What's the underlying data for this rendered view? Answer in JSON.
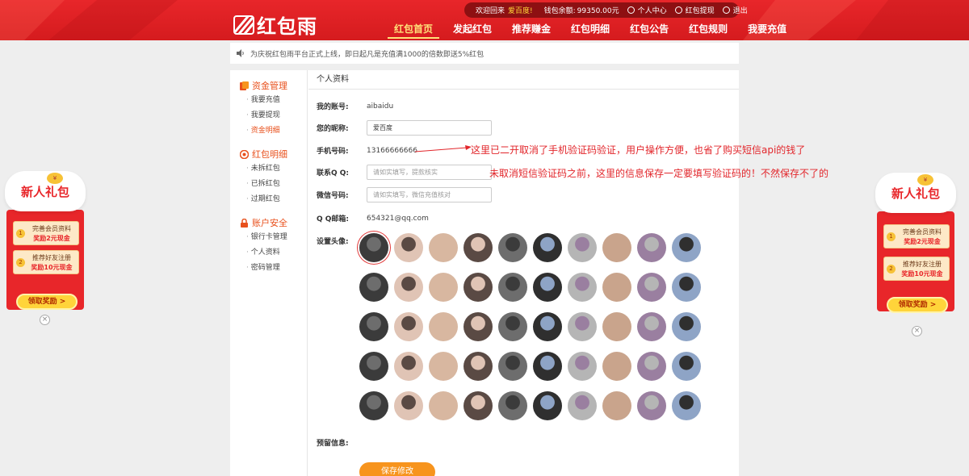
{
  "brand": {
    "logo_text": "红包雨"
  },
  "topbar": {
    "welcome_prefix": "欢迎回来",
    "username": "爱百度!",
    "balance_label": "钱包余额:",
    "balance_value": "99350.00元",
    "user_center": "个人中心",
    "withdraw": "红包提现",
    "logout": "退出"
  },
  "nav": {
    "items": [
      {
        "label": "红包首页",
        "active": true
      },
      {
        "label": "发起红包"
      },
      {
        "label": "推荐赚金"
      },
      {
        "label": "红包明细"
      },
      {
        "label": "红包公告"
      },
      {
        "label": "红包规则"
      },
      {
        "label": "我要充值"
      }
    ]
  },
  "notice": {
    "text": "为庆祝红包雨平台正式上线，即日起凡是充值满1000的倍数即送5%红包"
  },
  "sidebar": {
    "groups": [
      {
        "title": "资金管理",
        "items": [
          "我要充值",
          "我要提现",
          "资金明细"
        ]
      },
      {
        "title": "红包明细",
        "items": [
          "未拆红包",
          "已拆红包",
          "过期红包"
        ]
      },
      {
        "title": "账户安全",
        "items": [
          "银行卡管理",
          "个人资料",
          "密码管理"
        ]
      }
    ],
    "active_item": "资金明细"
  },
  "profile": {
    "section_title": "个人资料",
    "account_label": "我的账号:",
    "account_value": "aibaidu",
    "nickname_label": "您的昵称:",
    "nickname_value": "爱百度",
    "phone_label": "手机号码:",
    "phone_value": "13166666666",
    "qq_label": "联系Q Q:",
    "qq_placeholder": "请如实填写，提款核实",
    "wechat_label": "微信号码:",
    "wechat_placeholder": "请如实填写，微信充值核对",
    "qqmail_label": "Q Q邮箱:",
    "qqmail_value": "654321@qq.com",
    "avatar_label": "设置头像:",
    "reserved_label": "预留信息:",
    "save_label": "保存修改",
    "avatar_count": 50,
    "selected_avatar_index": 0
  },
  "annotations": {
    "note1": "这里已二开取消了手机验证码验证，用户操作方便，也省了购买短信api的钱了",
    "note2": "未取消短信验证码之前，这里的信息保存一定要填写验证码的！不然保存不了的"
  },
  "gift_panel": {
    "title": "新人礼包",
    "badge": "¥",
    "item1_line1": "完善会员资料",
    "item1_line2": "奖励2元现金",
    "item2_line1": "推荐好友注册",
    "item2_line2": "奖励10元现金",
    "button": "领取奖励 >",
    "num1": "1",
    "num2": "2",
    "close": "×"
  },
  "colors": {
    "brand_red": "#e8262a",
    "accent_orange": "#e8501c",
    "button_orange": "#f7941d",
    "annotation_red": "#e2262b"
  }
}
